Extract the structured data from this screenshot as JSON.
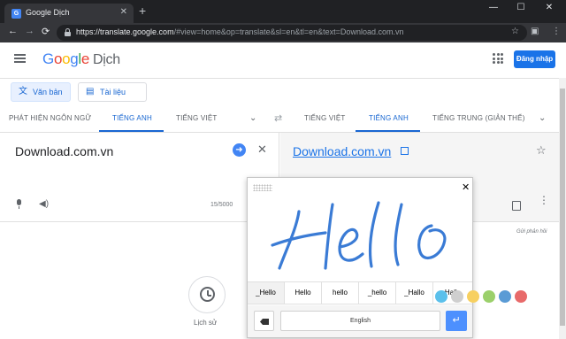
{
  "browser": {
    "tab_title": "Google Dịch",
    "tab_close": "✕",
    "new_tab": "+",
    "url_host": "https://translate.google.com",
    "url_path": "/#view=home&op=translate&sl=en&tl=en&text=Download.com.vn",
    "back": "←",
    "forward": "→",
    "reload": "⟳",
    "bookmark": "☆",
    "menu": "⋮"
  },
  "header": {
    "logo_product": "Dịch",
    "sign_in": "Đăng nhập"
  },
  "modes": {
    "text": "Văn bản",
    "documents": "Tài liệu"
  },
  "source_langs": [
    "PHÁT HIỆN NGÔN NGỮ",
    "TIẾNG ANH",
    "TIẾNG VIỆT"
  ],
  "target_langs": [
    "TIẾNG VIỆT",
    "TIẾNG ANH",
    "TIẾNG TRUNG (GIẢN THỂ)"
  ],
  "source": {
    "text": "Download.com.vn",
    "char_count": "15/5000"
  },
  "target": {
    "text": "Download.com.vn"
  },
  "feedback": "Gửi phản hồi",
  "history": {
    "label": "Lịch sử"
  },
  "handwriting": {
    "ink_word": "Hello",
    "suggestions": [
      "_Hello",
      "Hello",
      "hello",
      "_hello",
      "_Hallo",
      "Hallo"
    ],
    "space_label": "English",
    "enter": "↵"
  },
  "watermark": {
    "dot_colors": [
      "#5bc0eb",
      "#cfcfcf",
      "#f7d060",
      "#9bd06b",
      "#5a9bd5",
      "#e86a6a"
    ]
  }
}
